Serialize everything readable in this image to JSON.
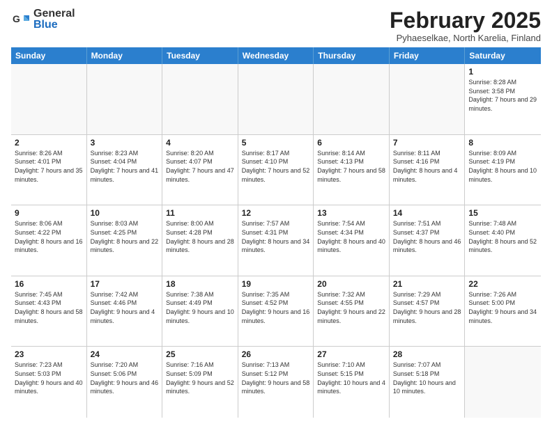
{
  "header": {
    "logo_general": "General",
    "logo_blue": "Blue",
    "title": "February 2025",
    "subtitle": "Pyhaeselkae, North Karelia, Finland"
  },
  "day_headers": [
    "Sunday",
    "Monday",
    "Tuesday",
    "Wednesday",
    "Thursday",
    "Friday",
    "Saturday"
  ],
  "weeks": [
    [
      {
        "day": "",
        "info": ""
      },
      {
        "day": "",
        "info": ""
      },
      {
        "day": "",
        "info": ""
      },
      {
        "day": "",
        "info": ""
      },
      {
        "day": "",
        "info": ""
      },
      {
        "day": "",
        "info": ""
      },
      {
        "day": "1",
        "info": "Sunrise: 8:28 AM\nSunset: 3:58 PM\nDaylight: 7 hours and 29 minutes."
      }
    ],
    [
      {
        "day": "2",
        "info": "Sunrise: 8:26 AM\nSunset: 4:01 PM\nDaylight: 7 hours and 35 minutes."
      },
      {
        "day": "3",
        "info": "Sunrise: 8:23 AM\nSunset: 4:04 PM\nDaylight: 7 hours and 41 minutes."
      },
      {
        "day": "4",
        "info": "Sunrise: 8:20 AM\nSunset: 4:07 PM\nDaylight: 7 hours and 47 minutes."
      },
      {
        "day": "5",
        "info": "Sunrise: 8:17 AM\nSunset: 4:10 PM\nDaylight: 7 hours and 52 minutes."
      },
      {
        "day": "6",
        "info": "Sunrise: 8:14 AM\nSunset: 4:13 PM\nDaylight: 7 hours and 58 minutes."
      },
      {
        "day": "7",
        "info": "Sunrise: 8:11 AM\nSunset: 4:16 PM\nDaylight: 8 hours and 4 minutes."
      },
      {
        "day": "8",
        "info": "Sunrise: 8:09 AM\nSunset: 4:19 PM\nDaylight: 8 hours and 10 minutes."
      }
    ],
    [
      {
        "day": "9",
        "info": "Sunrise: 8:06 AM\nSunset: 4:22 PM\nDaylight: 8 hours and 16 minutes."
      },
      {
        "day": "10",
        "info": "Sunrise: 8:03 AM\nSunset: 4:25 PM\nDaylight: 8 hours and 22 minutes."
      },
      {
        "day": "11",
        "info": "Sunrise: 8:00 AM\nSunset: 4:28 PM\nDaylight: 8 hours and 28 minutes."
      },
      {
        "day": "12",
        "info": "Sunrise: 7:57 AM\nSunset: 4:31 PM\nDaylight: 8 hours and 34 minutes."
      },
      {
        "day": "13",
        "info": "Sunrise: 7:54 AM\nSunset: 4:34 PM\nDaylight: 8 hours and 40 minutes."
      },
      {
        "day": "14",
        "info": "Sunrise: 7:51 AM\nSunset: 4:37 PM\nDaylight: 8 hours and 46 minutes."
      },
      {
        "day": "15",
        "info": "Sunrise: 7:48 AM\nSunset: 4:40 PM\nDaylight: 8 hours and 52 minutes."
      }
    ],
    [
      {
        "day": "16",
        "info": "Sunrise: 7:45 AM\nSunset: 4:43 PM\nDaylight: 8 hours and 58 minutes."
      },
      {
        "day": "17",
        "info": "Sunrise: 7:42 AM\nSunset: 4:46 PM\nDaylight: 9 hours and 4 minutes."
      },
      {
        "day": "18",
        "info": "Sunrise: 7:38 AM\nSunset: 4:49 PM\nDaylight: 9 hours and 10 minutes."
      },
      {
        "day": "19",
        "info": "Sunrise: 7:35 AM\nSunset: 4:52 PM\nDaylight: 9 hours and 16 minutes."
      },
      {
        "day": "20",
        "info": "Sunrise: 7:32 AM\nSunset: 4:55 PM\nDaylight: 9 hours and 22 minutes."
      },
      {
        "day": "21",
        "info": "Sunrise: 7:29 AM\nSunset: 4:57 PM\nDaylight: 9 hours and 28 minutes."
      },
      {
        "day": "22",
        "info": "Sunrise: 7:26 AM\nSunset: 5:00 PM\nDaylight: 9 hours and 34 minutes."
      }
    ],
    [
      {
        "day": "23",
        "info": "Sunrise: 7:23 AM\nSunset: 5:03 PM\nDaylight: 9 hours and 40 minutes."
      },
      {
        "day": "24",
        "info": "Sunrise: 7:20 AM\nSunset: 5:06 PM\nDaylight: 9 hours and 46 minutes."
      },
      {
        "day": "25",
        "info": "Sunrise: 7:16 AM\nSunset: 5:09 PM\nDaylight: 9 hours and 52 minutes."
      },
      {
        "day": "26",
        "info": "Sunrise: 7:13 AM\nSunset: 5:12 PM\nDaylight: 9 hours and 58 minutes."
      },
      {
        "day": "27",
        "info": "Sunrise: 7:10 AM\nSunset: 5:15 PM\nDaylight: 10 hours and 4 minutes."
      },
      {
        "day": "28",
        "info": "Sunrise: 7:07 AM\nSunset: 5:18 PM\nDaylight: 10 hours and 10 minutes."
      },
      {
        "day": "",
        "info": ""
      }
    ]
  ]
}
